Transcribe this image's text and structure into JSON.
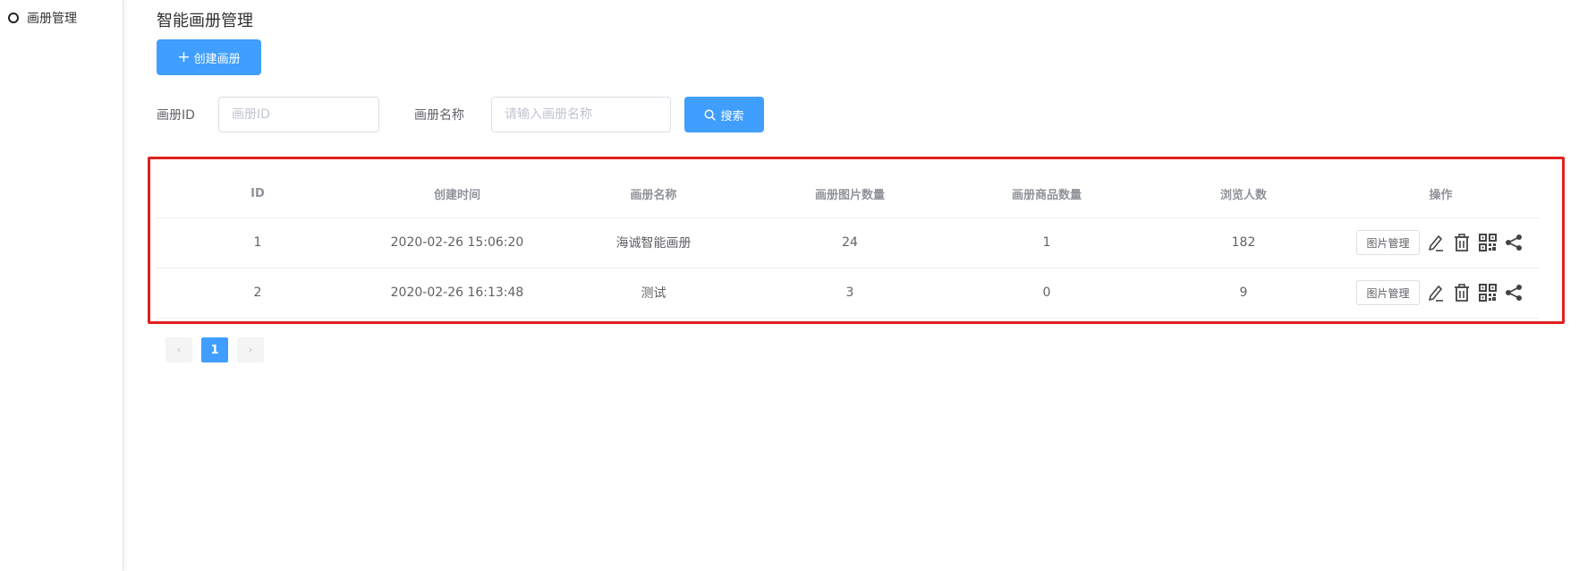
{
  "sidebar": {
    "items": [
      {
        "label": "画册管理"
      }
    ]
  },
  "page": {
    "title": "智能画册管理"
  },
  "toolbar": {
    "create_label": "创建画册"
  },
  "filters": {
    "id_label": "画册ID",
    "id_placeholder": "画册ID",
    "name_label": "画册名称",
    "name_placeholder": "请输入画册名称",
    "search_label": "搜索"
  },
  "table": {
    "headers": [
      "ID",
      "创建时间",
      "画册名称",
      "画册图片数量",
      "画册商品数量",
      "浏览人数",
      "操作"
    ],
    "rows": [
      {
        "id": "1",
        "created": "2020-02-26 15:06:20",
        "name": "海诚智能画册",
        "images": "24",
        "products": "1",
        "views": "182",
        "manage_label": "图片管理"
      },
      {
        "id": "2",
        "created": "2020-02-26 16:13:48",
        "name": "测试",
        "images": "3",
        "products": "0",
        "views": "9",
        "manage_label": "图片管理"
      }
    ]
  },
  "pagination": {
    "prev": "‹",
    "current": "1",
    "next": "›"
  },
  "colors": {
    "primary": "#409eff",
    "highlight": "#e0201f"
  },
  "icons": [
    "circle-icon",
    "plus-icon",
    "search-icon",
    "edit-icon",
    "trash-icon",
    "qrcode-icon",
    "share-icon"
  ]
}
